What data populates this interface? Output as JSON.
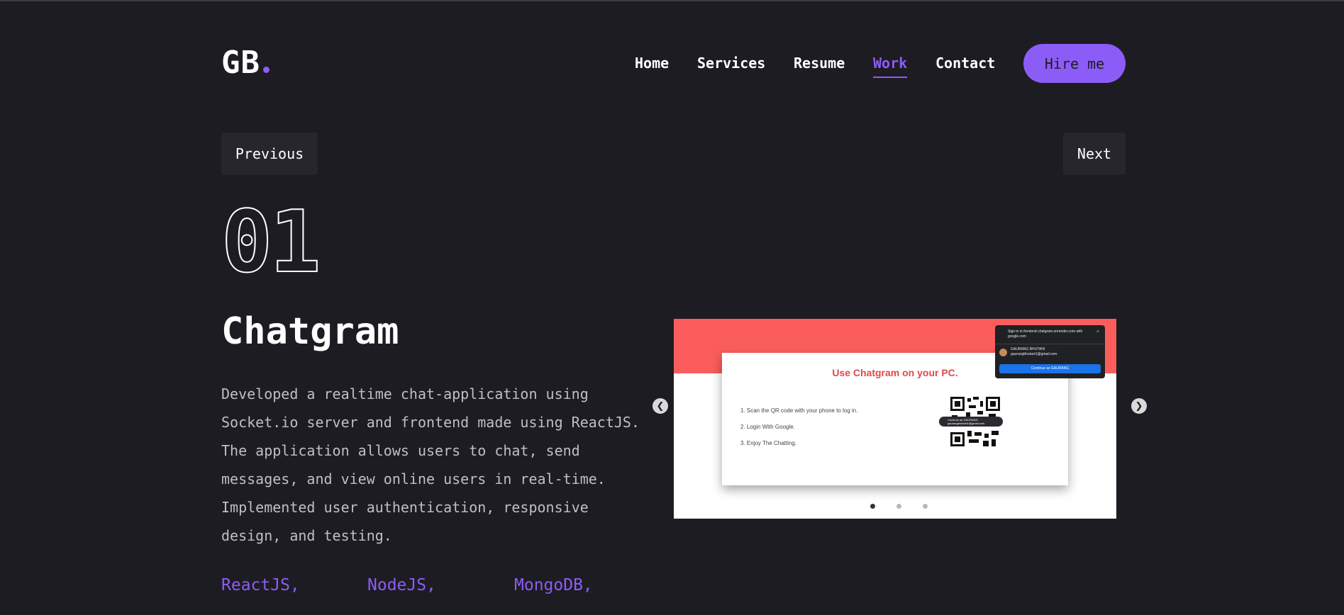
{
  "logo": {
    "text": "GB"
  },
  "nav": {
    "items": [
      "Home",
      "Services",
      "Resume",
      "Work",
      "Contact"
    ],
    "active": "Work",
    "hire_label": "Hire me"
  },
  "pager": {
    "previous": "Previous",
    "next": "Next"
  },
  "project": {
    "number": "01",
    "title": "Chatgram",
    "description": [
      "Developed a realtime chat-application using",
      "Socket.io server and frontend made using ReactJS.",
      "The application allows users to chat, send",
      "messages, and view online users in real-time.",
      "Implemented user authentication, responsive",
      "design, and testing."
    ],
    "techs": [
      "ReactJS,",
      "NodeJS,",
      "MongoDB,"
    ]
  },
  "slide": {
    "heading": "Use Chatgram on your PC.",
    "steps": [
      "1. Scan the QR code with your phone to log in.",
      "2. Login With Google.",
      "3. Enjoy The Chatting."
    ],
    "qr_badge": [
      "Continue as GAURANG",
      "gaurangbhutani1@gmail.com"
    ],
    "popup": {
      "title": "Sign in to frontend-chatgram.onrender.com with google.com",
      "close": "×",
      "name": "GAURANG BHUTANI",
      "email": "gaurangbhutani1@gmail.com",
      "button": "Continue as GAURANG"
    }
  },
  "carousel": {
    "slide_count": 3,
    "active_index": 0,
    "prev_icon": "chevron-left-icon",
    "next_icon": "chevron-right-icon"
  },
  "colors": {
    "background": "#1d1c22",
    "accent": "#8c5cf6",
    "slide_band": "#fb5d5d"
  }
}
